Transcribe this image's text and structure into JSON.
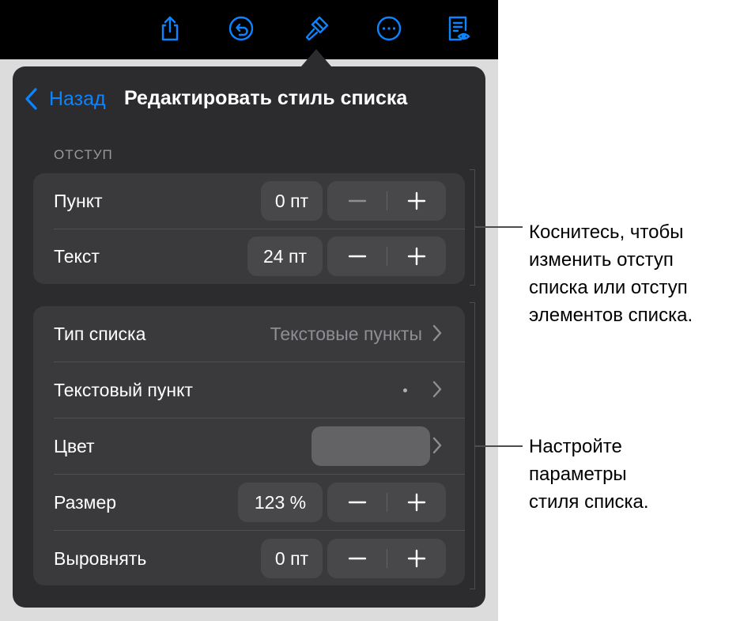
{
  "toolbar": {
    "icons": [
      "share-icon",
      "undo-icon",
      "format-brush-icon",
      "more-icon",
      "reading-view-icon"
    ],
    "color": "#0a84ff"
  },
  "popover": {
    "back_label": "Назад",
    "title": "Редактировать стиль списка",
    "indent_section_label": "ОТСТУП",
    "indent_rows": [
      {
        "label": "Пункт",
        "value": "0 пт"
      },
      {
        "label": "Текст",
        "value": "24 пт"
      }
    ],
    "style_rows": {
      "list_type": {
        "label": "Тип списка",
        "value": "Текстовые пункты"
      },
      "text_bullet": {
        "label": "Текстовый пункт",
        "value": "•"
      },
      "color": {
        "label": "Цвет",
        "swatch_color": "#636366"
      },
      "size": {
        "label": "Размер",
        "value": "123 %"
      },
      "align": {
        "label": "Выровнять",
        "value": "0 пт"
      }
    }
  },
  "callouts": {
    "indent": [
      "Коснитесь, чтобы",
      "изменить отступ",
      "списка или отступ",
      "элементов списка."
    ],
    "style": [
      "Настройте",
      "параметры",
      "стиля списка."
    ]
  }
}
